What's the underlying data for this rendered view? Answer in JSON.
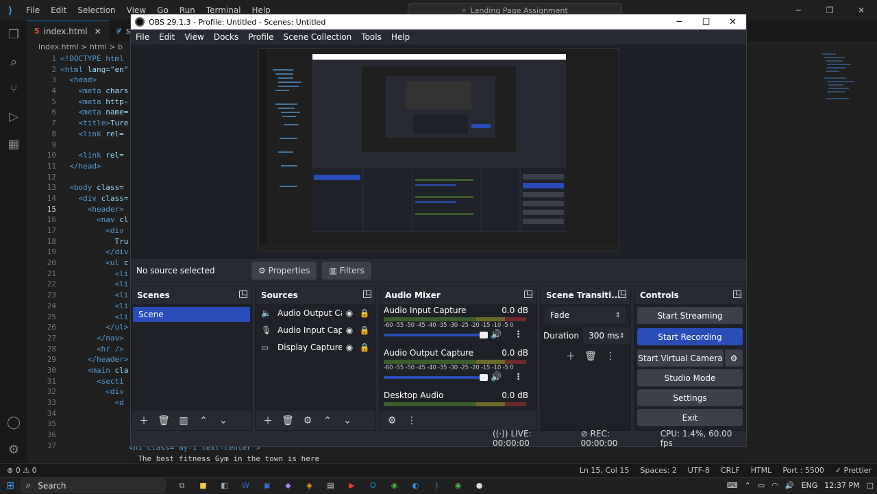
{
  "vscode": {
    "menu": [
      "File",
      "Edit",
      "Selection",
      "View",
      "Go",
      "Run",
      "Terminal",
      "Help"
    ],
    "search": "Landing Page Assignment",
    "tabs": [
      {
        "label": "index.html",
        "type": "html",
        "active": true
      },
      {
        "label": "style",
        "type": "css",
        "active": false
      }
    ],
    "breadcrumb": "index.html  >  html  >  b",
    "line_numbers": [
      "1",
      "2",
      "3",
      "4",
      "5",
      "6",
      "7",
      "8",
      "9",
      "10",
      "11",
      "12",
      "13",
      "14",
      "15",
      "16",
      "17",
      "18",
      "19",
      "20",
      "21",
      "22",
      "23",
      "24",
      "25",
      "26",
      "27",
      "28",
      "29",
      "30",
      "31",
      "32",
      "33",
      "34",
      "35",
      "36",
      "37"
    ],
    "code_lines": [
      {
        "tag": "<!DOCTYPE html",
        "rest": ""
      },
      {
        "tag": "<html",
        "rest": " lang=\"en\""
      },
      {
        "tag": "  <head>",
        "rest": ""
      },
      {
        "tag": "    <meta",
        "rest": " chars"
      },
      {
        "tag": "    <meta",
        "rest": " http-"
      },
      {
        "tag": "    <meta",
        "rest": " name="
      },
      {
        "tag": "    <title>",
        "rest": "Ture"
      },
      {
        "tag": "    <link",
        "rest": " rel="
      },
      {
        "tag": "",
        "rest": ""
      },
      {
        "tag": "    <link",
        "rest": " rel="
      },
      {
        "tag": "  </head>",
        "rest": ""
      },
      {
        "tag": "",
        "rest": ""
      },
      {
        "tag": "  <body",
        "rest": " class="
      },
      {
        "tag": "    <div",
        "rest": " class="
      },
      {
        "tag": "      <header>",
        "rest": ""
      },
      {
        "tag": "        <nav",
        "rest": " cl"
      },
      {
        "tag": "          <div",
        "rest": ""
      },
      {
        "tag": "",
        "rest": "            Tru"
      },
      {
        "tag": "          </div",
        "rest": ""
      },
      {
        "tag": "          <ul",
        "rest": " c"
      },
      {
        "tag": "            <li",
        "rest": ""
      },
      {
        "tag": "            <li",
        "rest": ""
      },
      {
        "tag": "            <li",
        "rest": ""
      },
      {
        "tag": "            <li",
        "rest": ""
      },
      {
        "tag": "            <li",
        "rest": ""
      },
      {
        "tag": "          </ul>",
        "rest": ""
      },
      {
        "tag": "        </nav>",
        "rest": ""
      },
      {
        "tag": "        <hr />",
        "rest": ""
      },
      {
        "tag": "      </header>",
        "rest": ""
      },
      {
        "tag": "      <main",
        "rest": " cla"
      },
      {
        "tag": "        <secti",
        "rest": ""
      },
      {
        "tag": "          <div",
        "rest": ""
      },
      {
        "tag": "            <d",
        "rest": ""
      },
      {
        "tag": "",
        "rest": ""
      },
      {
        "tag": "",
        "rest": ""
      },
      {
        "tag": "",
        "rest": ""
      },
      {
        "tag": "",
        "rest": ""
      }
    ],
    "bottom_code_1": "<h1 class=\"my-1 text-center\">",
    "bottom_code_2": "  The best fitness Gym in the town is here",
    "status_left": "⊗ 0 ⚠ 0",
    "status_right": [
      "Ln 15, Col 15",
      "Spaces: 2",
      "UTF-8",
      "CRLF",
      "HTML",
      "Port : 5500",
      "✓ Prettier"
    ]
  },
  "obs": {
    "title": "OBS 29.1.3 - Profile: Untitled - Scenes: Untitled",
    "menu": [
      "File",
      "Edit",
      "View",
      "Docks",
      "Profile",
      "Scene Collection",
      "Tools",
      "Help"
    ],
    "no_source": "No source selected",
    "properties_label": "Properties",
    "filters_label": "Filters",
    "scenes": {
      "title": "Scenes",
      "items": [
        "Scene"
      ]
    },
    "sources": {
      "title": "Sources",
      "items": [
        {
          "name": "Audio Output Capt",
          "icon": "speaker-icon"
        },
        {
          "name": "Audio Input Captu",
          "icon": "mic-icon"
        },
        {
          "name": "Display Capture",
          "icon": "monitor-icon"
        }
      ]
    },
    "mixer": {
      "title": "Audio Mixer",
      "ticks": "-60 -55 -50 -45 -40 -35 -30 -25 -20 -15 -10  -5   0",
      "channels": [
        {
          "name": "Audio Input Capture",
          "db": "0.0 dB"
        },
        {
          "name": "Audio Output Capture",
          "db": "0.0 dB"
        },
        {
          "name": "Desktop Audio",
          "db": "0.0 dB"
        }
      ]
    },
    "transitions": {
      "title": "Scene Transiti...",
      "selected": "Fade",
      "duration_label": "Duration",
      "duration_value": "300 ms"
    },
    "controls": {
      "title": "Controls",
      "start_streaming": "Start Streaming",
      "start_recording": "Start Recording",
      "start_virtual_camera": "Start Virtual Camera",
      "studio_mode": "Studio Mode",
      "settings": "Settings",
      "exit": "Exit"
    },
    "status": {
      "live": "LIVE: 00:00:00",
      "rec": "REC: 00:00:00",
      "cpu": "CPU: 1.4%, 60.00 fps"
    }
  },
  "taskbar": {
    "search": "Search",
    "time": "12:37 PM",
    "lang": "ENG"
  }
}
